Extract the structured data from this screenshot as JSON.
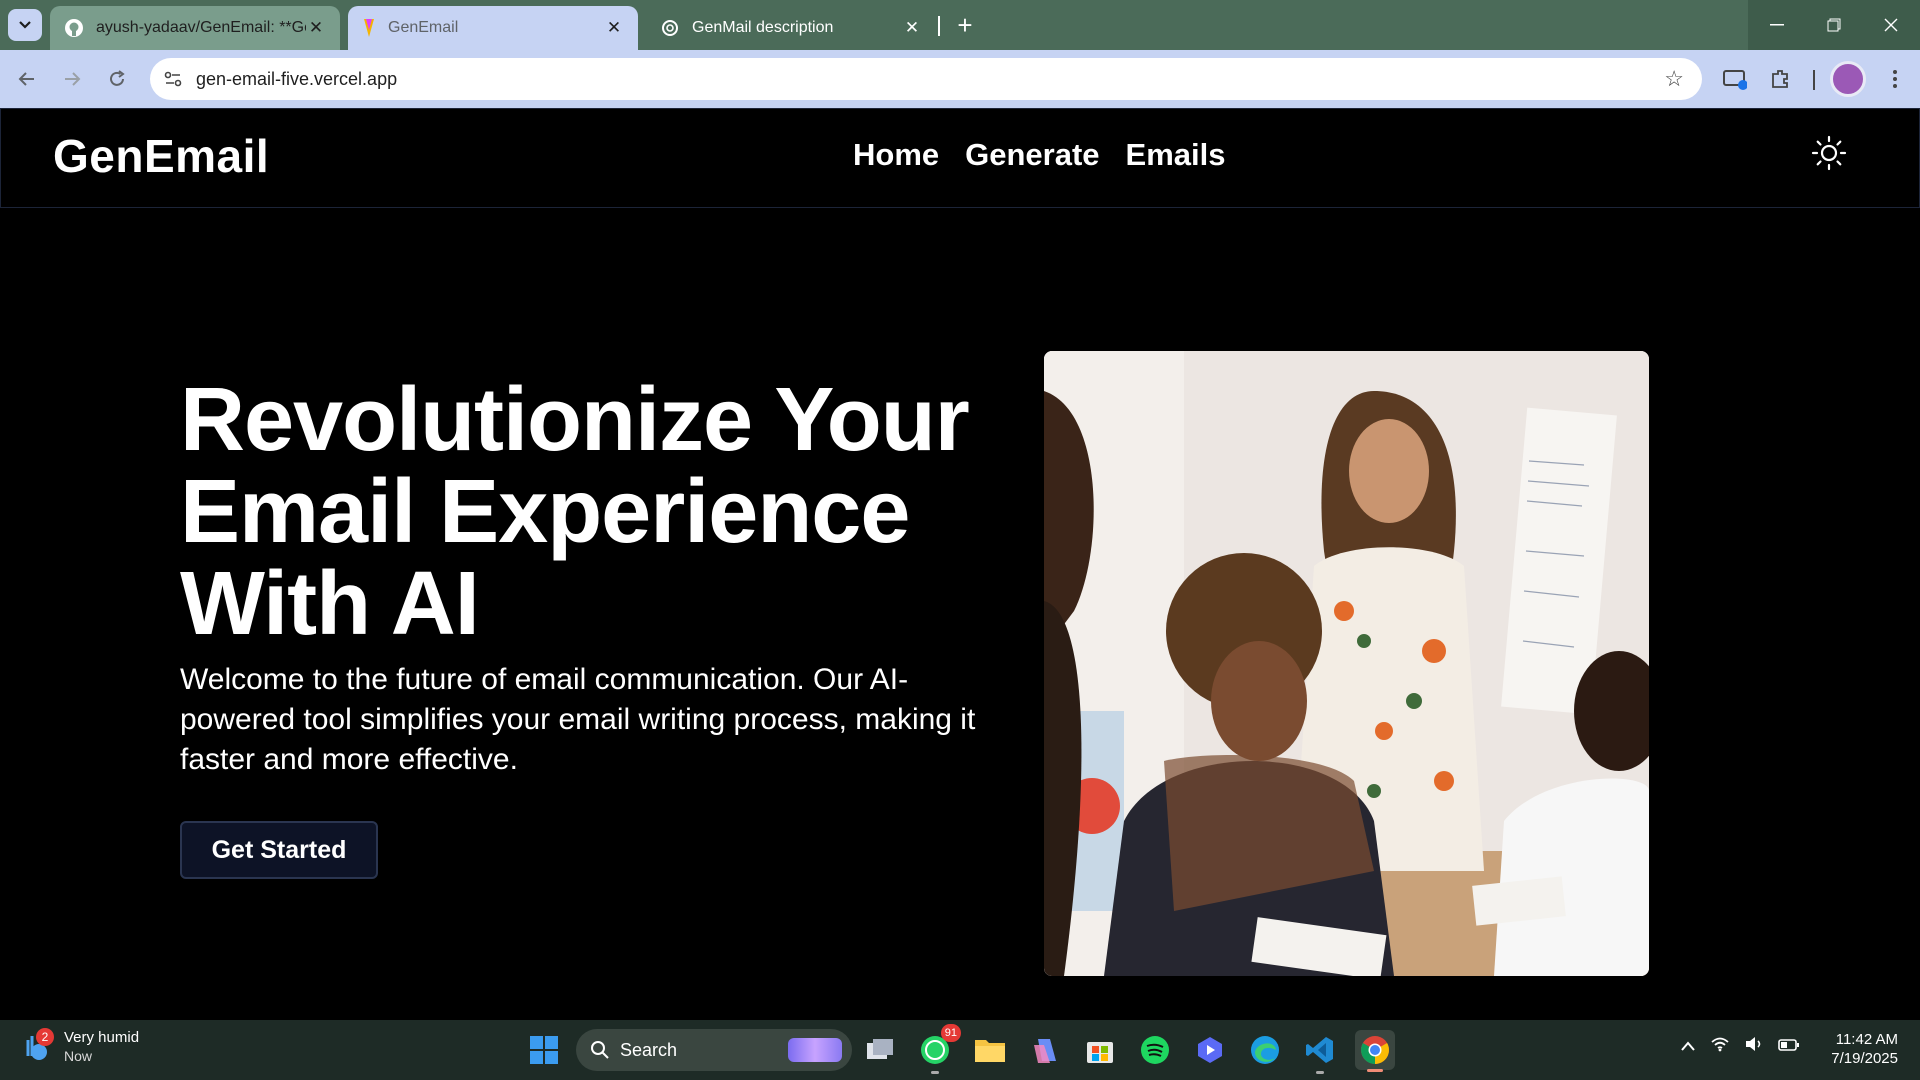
{
  "browser": {
    "tabs": [
      {
        "title": "ayush-yadaav/GenEmail: **GenEmail",
        "icon": "github-icon"
      },
      {
        "title": "GenEmail",
        "icon": "vercel-pen-icon",
        "active": true
      },
      {
        "title": "GenMail description",
        "icon": "openai-icon"
      }
    ],
    "new_tab": "+",
    "url": "gen-email-five.vercel.app",
    "colors": {
      "tabbar": "#4b6b59",
      "toolbar": "#c6d3f3"
    }
  },
  "site": {
    "logo": "GenEmail",
    "nav": [
      "Home",
      "Generate",
      "Emails"
    ],
    "hero": {
      "title": "Revolutionize Your Email Experience With AI",
      "description": "Welcome to the future of email communication. Our AI-powered tool simplifies your email writing process, making it faster and more effective.",
      "cta_label": "Get Started",
      "image_alt": "people collaborating at a table"
    },
    "colors": {
      "background": "#000000",
      "button": "#0d1326",
      "text": "#ffffff"
    }
  },
  "taskbar": {
    "weather": {
      "title": "Very humid",
      "sub": "Now",
      "badge": "2"
    },
    "search_label": "Search",
    "whatsapp_badge": "91",
    "clock": {
      "time": "11:42 AM",
      "date": "7/19/2025"
    }
  }
}
